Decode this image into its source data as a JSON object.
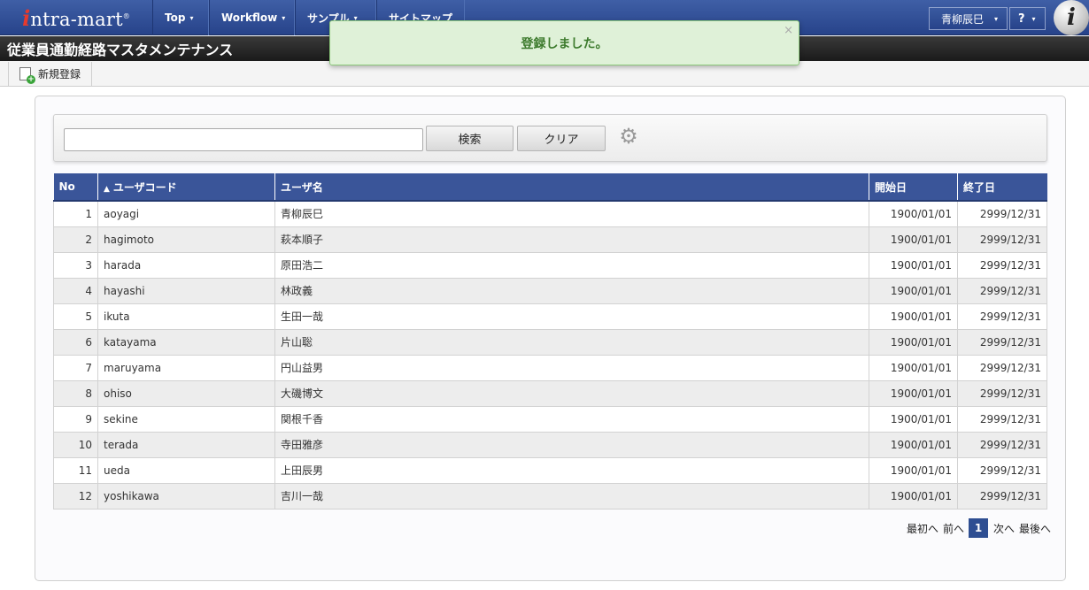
{
  "nav": {
    "logo": {
      "first": "i",
      "rest": "ntra-mart",
      "mark": "®"
    },
    "items": [
      {
        "label": "Top"
      },
      {
        "label": "Workflow"
      },
      {
        "label": "サンプル"
      },
      {
        "label": "サイトマップ"
      }
    ],
    "caret": "▾",
    "user_label": "青柳辰巳",
    "help_label": "?",
    "info_glyph": "i"
  },
  "page": {
    "title": "従業員通勤経路マスタメンテナンス"
  },
  "toolbar": {
    "new_label": "新規登録"
  },
  "toast": {
    "message": "登録しました。",
    "close": "×"
  },
  "search": {
    "input_value": "",
    "search_label": "検索",
    "clear_label": "クリア"
  },
  "table": {
    "headers": [
      "No",
      "ユーザコード",
      "ユーザ名",
      "開始日",
      "終了日"
    ],
    "sort_indicator": "▲",
    "rows": [
      {
        "no": "1",
        "code": "aoyagi",
        "name": "青柳辰巳",
        "start": "1900/01/01",
        "end": "2999/12/31"
      },
      {
        "no": "2",
        "code": "hagimoto",
        "name": "萩本順子",
        "start": "1900/01/01",
        "end": "2999/12/31"
      },
      {
        "no": "3",
        "code": "harada",
        "name": "原田浩二",
        "start": "1900/01/01",
        "end": "2999/12/31"
      },
      {
        "no": "4",
        "code": "hayashi",
        "name": "林政義",
        "start": "1900/01/01",
        "end": "2999/12/31"
      },
      {
        "no": "5",
        "code": "ikuta",
        "name": "生田一哉",
        "start": "1900/01/01",
        "end": "2999/12/31"
      },
      {
        "no": "6",
        "code": "katayama",
        "name": "片山聡",
        "start": "1900/01/01",
        "end": "2999/12/31"
      },
      {
        "no": "7",
        "code": "maruyama",
        "name": "円山益男",
        "start": "1900/01/01",
        "end": "2999/12/31"
      },
      {
        "no": "8",
        "code": "ohiso",
        "name": "大磯博文",
        "start": "1900/01/01",
        "end": "2999/12/31"
      },
      {
        "no": "9",
        "code": "sekine",
        "name": "関根千香",
        "start": "1900/01/01",
        "end": "2999/12/31"
      },
      {
        "no": "10",
        "code": "terada",
        "name": "寺田雅彦",
        "start": "1900/01/01",
        "end": "2999/12/31"
      },
      {
        "no": "11",
        "code": "ueda",
        "name": "上田辰男",
        "start": "1900/01/01",
        "end": "2999/12/31"
      },
      {
        "no": "12",
        "code": "yoshikawa",
        "name": "吉川一哉",
        "start": "1900/01/01",
        "end": "2999/12/31"
      }
    ]
  },
  "pager": {
    "first": "最初へ",
    "prev": "前へ",
    "current": "1",
    "next": "次へ",
    "last": "最後へ"
  },
  "colors": {
    "nav_bg": "#27438a",
    "header_bg": "#3a5599",
    "toast_bg": "#dff1d8",
    "toast_text": "#3c7a2c",
    "page_current": "#2e4e92"
  }
}
